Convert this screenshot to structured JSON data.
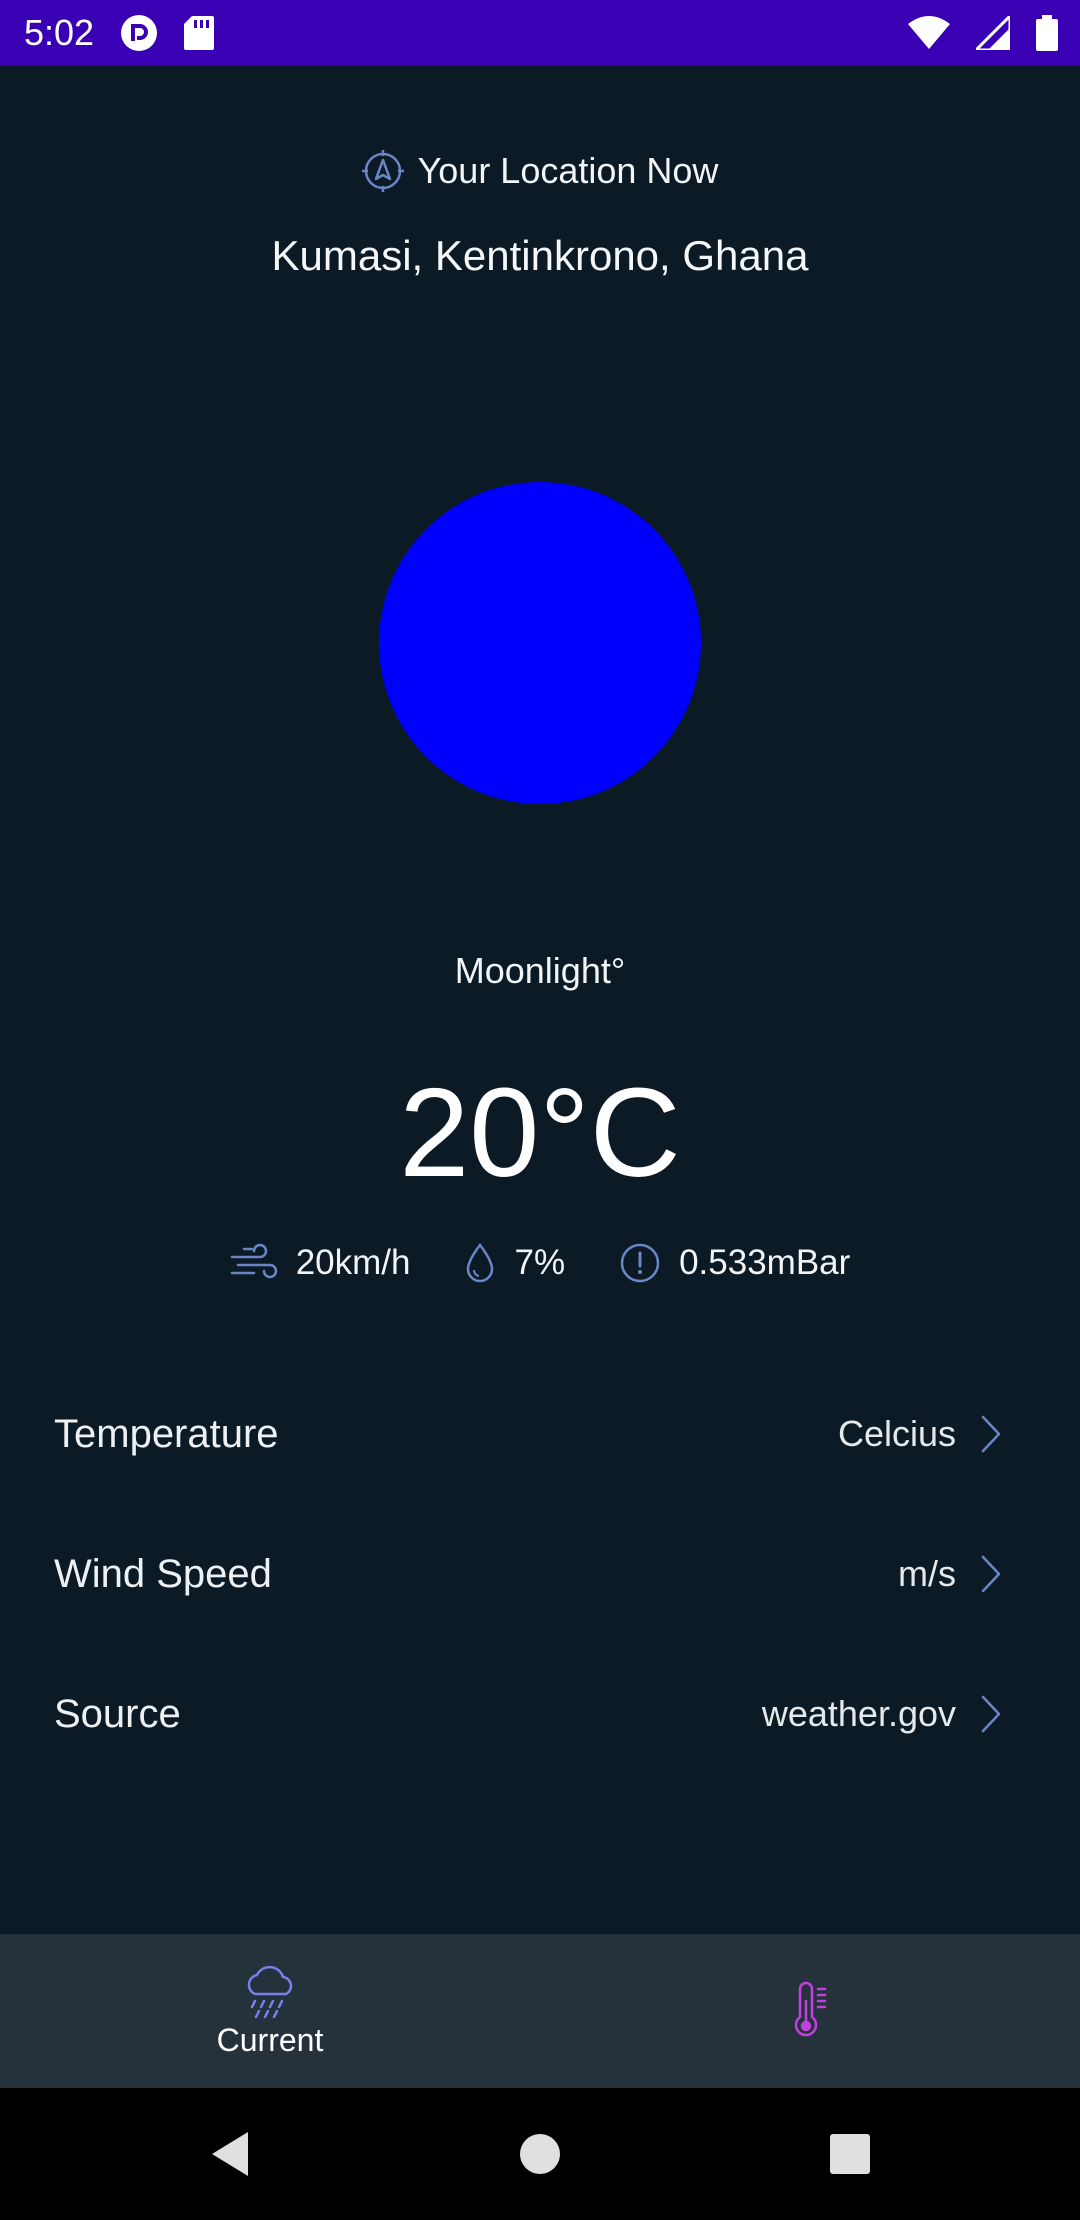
{
  "status_bar": {
    "time": "5:02",
    "icons": [
      "pocket-casts-icon",
      "sd-card-icon",
      "wifi-icon",
      "signal-icon",
      "battery-icon"
    ]
  },
  "location": {
    "header": "Your Location Now",
    "place": "Kumasi, Kentinkrono, Ghana"
  },
  "weather": {
    "orb_color": "#0000ff",
    "condition": "Moonlight°",
    "temperature": "20°C",
    "wind": "20km/h",
    "humidity": "7%",
    "pressure": "0.533mBar"
  },
  "settings": [
    {
      "label": "Temperature",
      "value": "Celcius"
    },
    {
      "label": "Wind Speed",
      "value": "m/s"
    },
    {
      "label": "Source",
      "value": "weather.gov"
    }
  ],
  "bottom_nav": {
    "current_label": "Current",
    "items": [
      "cloud-rain-icon",
      "thermometer-icon"
    ]
  },
  "colors": {
    "status_bar": "#3a00b3",
    "background": "#0b1a24",
    "nav_bar": "#25323b",
    "accent_icon": "#6a86c6",
    "nav_current_icon": "#7a7ff0",
    "nav_thermo_icon": "#c040e0"
  }
}
